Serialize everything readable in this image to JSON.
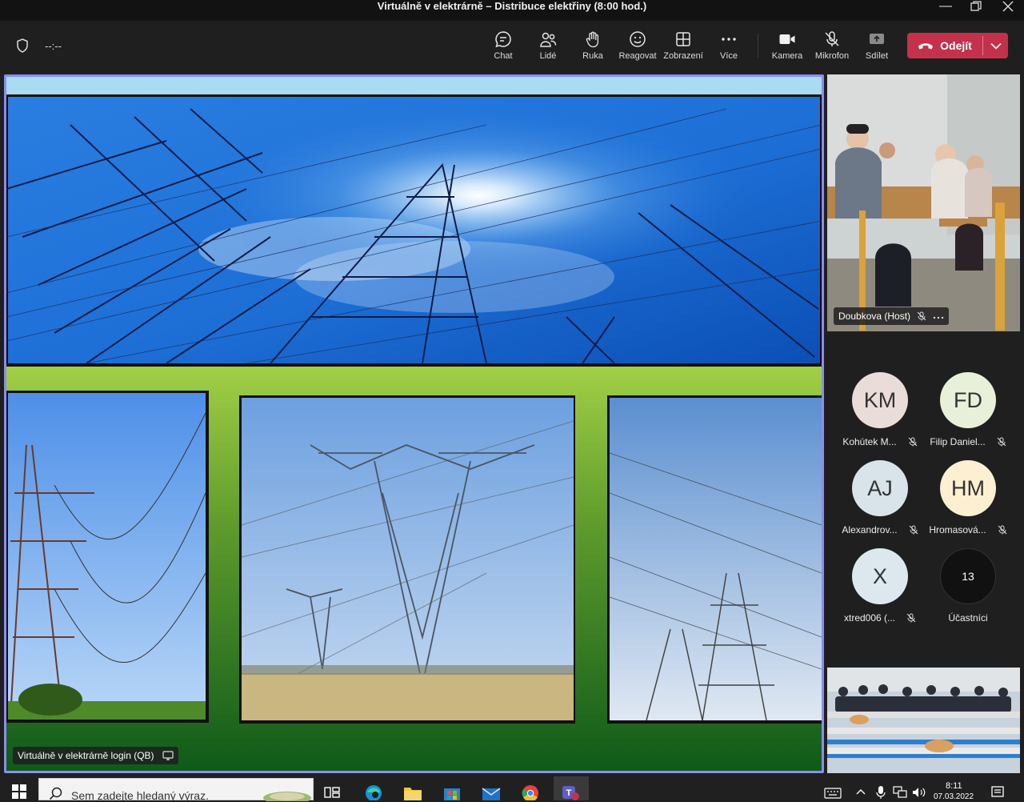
{
  "window": {
    "title": "Virtuálně v elektrárně – Distribuce elektřiny (8:00 hod.)"
  },
  "toolbar": {
    "timer": "--:--",
    "buttons": {
      "chat": "Chat",
      "people": "Lidé",
      "raise_hand": "Ruka",
      "react": "Reagovat",
      "view": "Zobrazení",
      "more": "Více",
      "camera": "Kamera",
      "mic": "Mikrofon",
      "share": "Sdílet"
    },
    "leave_label": "Odejít"
  },
  "stage": {
    "label": "Virtuálně v elektrárně login (QB)"
  },
  "video_host": {
    "label": "Doubkova (Host)"
  },
  "participants": [
    {
      "initials": "KM",
      "name": "Kohútek M...",
      "color": "#eadcd8"
    },
    {
      "initials": "FD",
      "name": "Filip Daniel...",
      "color": "#e9f0d9"
    },
    {
      "initials": "AJ",
      "name": "Alexandrov...",
      "color": "#d9e4ea"
    },
    {
      "initials": "HM",
      "name": "Hromasová...",
      "color": "#fdf0d2"
    },
    {
      "initials": "X",
      "name": "xtred006 (...",
      "color": "#dce8ee"
    }
  ],
  "participants_more": {
    "count": "13",
    "label": "Účastníci"
  },
  "taskbar": {
    "search_placeholder": "Sem zadejte hledaný výraz.",
    "time": "8:11",
    "date": "07.03.2022"
  }
}
